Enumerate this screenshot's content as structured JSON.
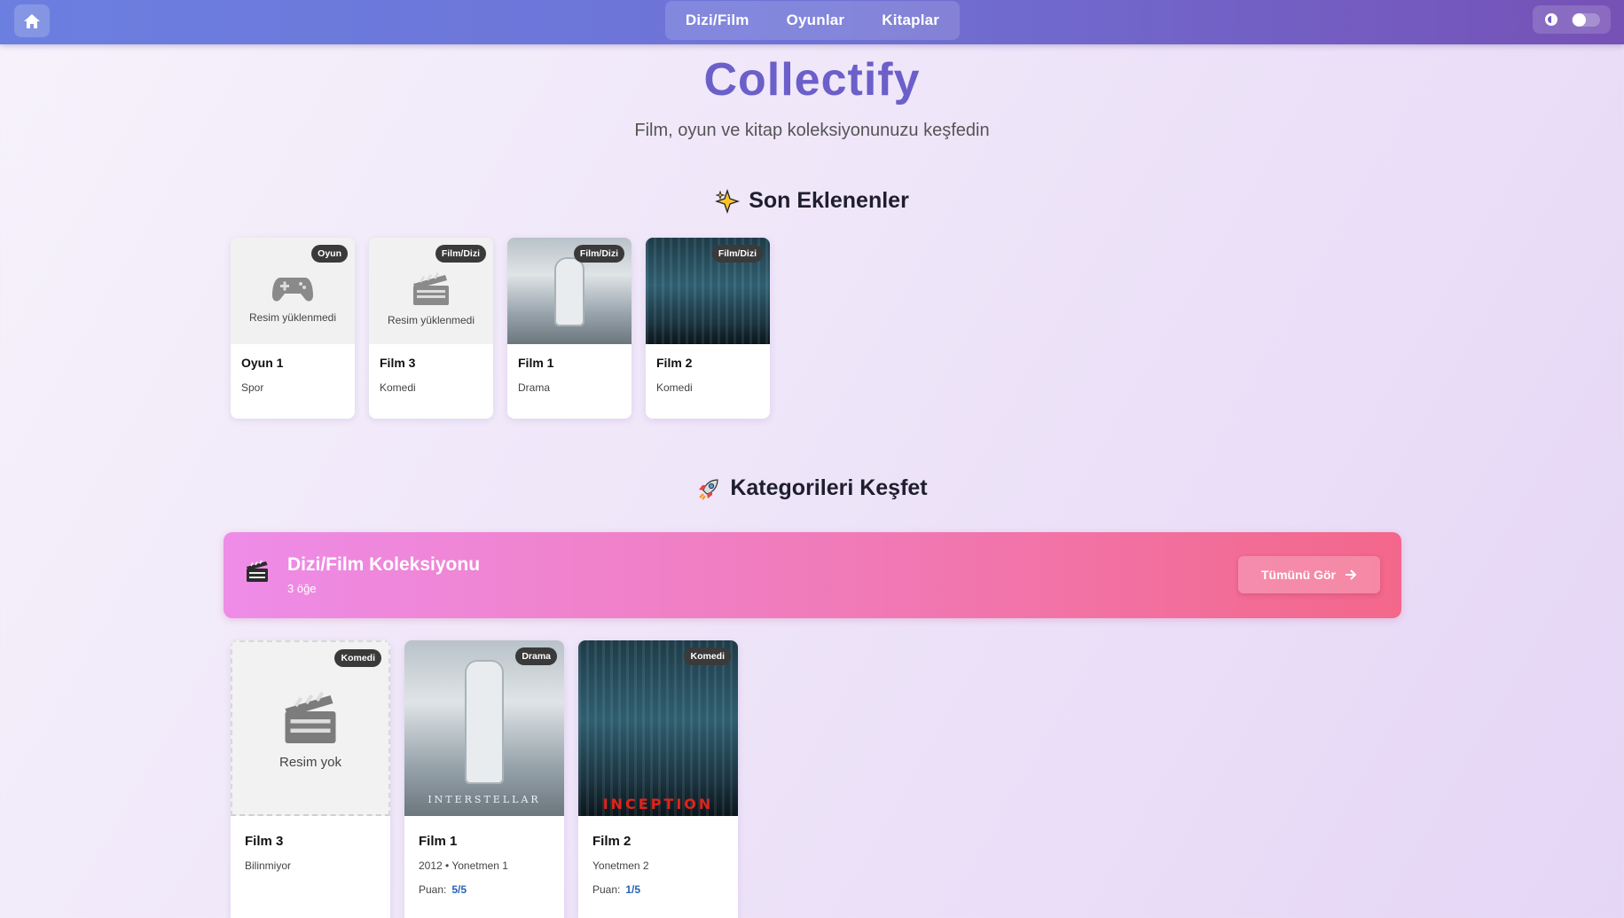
{
  "nav": {
    "items": [
      "Dizi/Film",
      "Oyunlar",
      "Kitaplar"
    ]
  },
  "hero": {
    "brand": "Collectify",
    "tagline": "Film, oyun ve kitap koleksiyonunuzu keşfedin"
  },
  "recent": {
    "title": "Son Eklenenler",
    "icon": "sparkles-icon",
    "items": [
      {
        "title": "Oyun 1",
        "genre": "Spor",
        "badge": "Oyun",
        "placeholder": "Resim yüklenmedi",
        "icon": "gamepad-icon"
      },
      {
        "title": "Film 3",
        "genre": "Komedi",
        "badge": "Film/Dizi",
        "placeholder": "Resim yüklenmedi",
        "icon": "clapperboard-icon"
      },
      {
        "title": "Film 1",
        "genre": "Drama",
        "badge": "Film/Dizi",
        "poster": "interstellar"
      },
      {
        "title": "Film 2",
        "genre": "Komedi",
        "badge": "Film/Dizi",
        "poster": "inception"
      }
    ]
  },
  "explore": {
    "title": "Kategorileri Keşfet",
    "icon": "rocket-icon"
  },
  "category": {
    "title": "Dizi/Film Koleksiyonu",
    "count": "3 öğe",
    "see_all": "Tümünü Gör",
    "colors": {
      "start": "#ee8ce8",
      "end": "#f3678a"
    },
    "items": [
      {
        "title": "Film 3",
        "subtitle": "Bilinmiyor",
        "badge": "Komedi",
        "placeholder": "Resim yok"
      },
      {
        "title": "Film 1",
        "subtitle": "2012 • Yonetmen 1",
        "badge": "Drama",
        "rating_label": "Puan:",
        "rating": "5/5",
        "poster_text": "INTERSTELLAR"
      },
      {
        "title": "Film 2",
        "subtitle": "Yonetmen 2",
        "badge": "Komedi",
        "rating_label": "Puan:",
        "rating": "1/5",
        "poster_text": "INCEPTION"
      }
    ]
  }
}
